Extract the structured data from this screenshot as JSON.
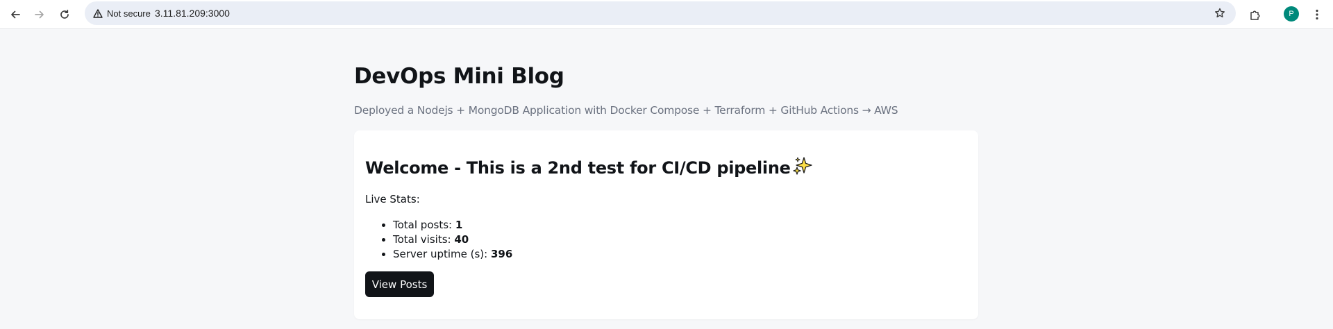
{
  "browser": {
    "security_label": "Not secure",
    "url": "3.11.81.209:3000",
    "profile_initial": "P",
    "icons": [
      "back-arrow-icon",
      "forward-arrow-icon",
      "reload-icon",
      "warning-icon",
      "star-icon",
      "extensions-icon",
      "more-menu-icon"
    ]
  },
  "page": {
    "title": "DevOps Mini Blog",
    "subtitle": "Deployed a Nodejs + MongoDB Application with Docker Compose + Terraform + GitHub Actions → AWS"
  },
  "card": {
    "heading": "Welcome - This is a 2nd test for CI/CD pipeline",
    "heading_emoji": "sparkles-icon",
    "stats_label": "Live Stats:",
    "stats": [
      {
        "label": "Total posts: ",
        "value": "1"
      },
      {
        "label": "Total visits: ",
        "value": "40"
      },
      {
        "label": "Server uptime (s): ",
        "value": "396"
      }
    ],
    "button_label": "View Posts"
  },
  "colors": {
    "page_bg": "#f6f7f9",
    "card_bg": "#ffffff",
    "button_bg": "#111418",
    "subtitle": "#6b7280",
    "avatar": "#00897b"
  }
}
